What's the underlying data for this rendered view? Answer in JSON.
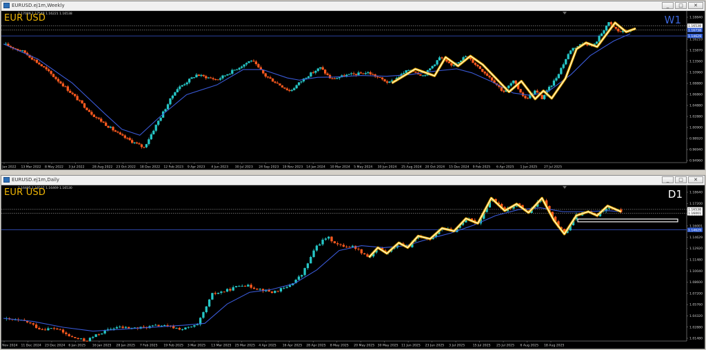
{
  "colors": {
    "background": "#000000",
    "bull_candle": "#26c6c6",
    "bear_candle": "#ff5a1f",
    "moving_average": "#3a5ad8",
    "zigzag_outer": "#f5b400",
    "zigzag_inner": "#ffffff",
    "symbol_label": "#f2b705",
    "grid_line": "#8a8a8a",
    "level_line": "#3a5ad8"
  },
  "window_buttons": [
    "minimize-icon",
    "restore-icon",
    "close-icon"
  ],
  "chart_data": [
    {
      "type": "candlestick",
      "window_title": "EURUSD.ej1m,Weekly",
      "ohlc_header": "1.17089 1.17548 1.16221 1.16538",
      "symbol_label": "EUR USD",
      "timeframe_label": "W1",
      "ylim": [
        0.9376,
        1.1945
      ],
      "y_ticks": [
        "1.18840",
        "1.16538",
        "1.16210",
        "1.15870",
        "1.13560",
        "1.10960",
        "1.08880",
        "1.06860",
        "1.04880",
        "1.02880",
        "1.00900",
        "0.98920",
        "0.96940",
        "0.94960"
      ],
      "price_markers": [
        {
          "label": "1.16538",
          "value": 1.1738,
          "bg": "#ffffff",
          "fg": "#000000"
        },
        {
          "label": "1.16738",
          "value": 1.1664,
          "bg": "#2f5bd0",
          "fg": "#ffffff"
        },
        {
          "label": "1.14629",
          "value": 1.1563,
          "bg": "#2f5bd0",
          "fg": "#ffffff"
        }
      ],
      "horizontal_lines": [
        {
          "value": 1.1738,
          "style": "dotted",
          "color": "#8a8a8a"
        },
        {
          "value": 1.1664,
          "style": "dotted",
          "color": "#8a8a8a"
        },
        {
          "value": 1.1563,
          "style": "solid",
          "color": "#3a5ad8"
        }
      ],
      "x_labels": [
        "16 Jan 2022",
        "13 Mar 2022",
        "8 May 2022",
        "3 Jul 2022",
        "28 Aug 2022",
        "23 Oct 2022",
        "18 Dec 2022",
        "12 Feb 2023",
        "9 Apr 2023",
        "4 Jun 2023",
        "30 Jul 2023",
        "24 Sep 2023",
        "19 Nov 2023",
        "14 Jan 2024",
        "10 Mar 2024",
        "5 May 2024",
        "30 Jun 2024",
        "25 Aug 2024",
        "20 Oct 2024",
        "15 Dec 2024",
        "9 Feb 2025",
        "6 Apr 2025",
        "1 Jun 2025",
        "27 Jul 2025"
      ],
      "price_path": [
        [
          0,
          1.1425
        ],
        [
          1.5,
          1.1285
        ],
        [
          3,
          1.1001
        ],
        [
          4.5,
          1.0676
        ],
        [
          6.5,
          1.0198
        ],
        [
          8.5,
          0.9844
        ],
        [
          10.2,
          0.9633
        ],
        [
          11.2,
          1.0076
        ],
        [
          12.5,
          1.0629
        ],
        [
          14,
          1.0893
        ],
        [
          15.5,
          1.0806
        ],
        [
          17,
          1.1008
        ],
        [
          18,
          1.1147
        ],
        [
          19,
          1.0875
        ],
        [
          20.8,
          1.0608
        ],
        [
          22,
          1.0864
        ],
        [
          23,
          1.1014
        ],
        [
          23.8,
          1.0814
        ],
        [
          25,
          1.0889
        ],
        [
          26.5,
          1.0929
        ],
        [
          28,
          1.0749
        ],
        [
          29.5,
          1.0992
        ],
        [
          30.5,
          1.0873
        ],
        [
          31.7,
          1.1196
        ],
        [
          32.5,
          1.1044
        ],
        [
          33.6,
          1.1216
        ],
        [
          34.3,
          1.1066
        ],
        [
          35.3,
          1.0852
        ],
        [
          36.3,
          1.0597
        ],
        [
          37,
          1.0782
        ],
        [
          37.9,
          1.0474
        ],
        [
          38.6,
          1.0616
        ],
        [
          39.1,
          1.0485
        ],
        [
          40.1,
          1.0829
        ],
        [
          41.2,
          1.1336
        ],
        [
          42.2,
          1.1446
        ],
        [
          42.8,
          1.1375
        ],
        [
          43.9,
          1.1791
        ],
        [
          44.7,
          1.1633
        ],
        [
          45.5,
          1.165
        ]
      ],
      "moving_average": [
        [
          0,
          1.1423
        ],
        [
          2.5,
          1.1163
        ],
        [
          5,
          1.0749
        ],
        [
          7.4,
          1.0211
        ],
        [
          8.6,
          0.9951
        ],
        [
          9.9,
          0.9849
        ],
        [
          11.3,
          1.0155
        ],
        [
          13.3,
          1.0549
        ],
        [
          15.5,
          1.0718
        ],
        [
          17.4,
          1.0982
        ],
        [
          18.8,
          1.0982
        ],
        [
          20.6,
          1.0838
        ],
        [
          21.5,
          1.0799
        ],
        [
          22.8,
          1.0849
        ],
        [
          24,
          1.0853
        ],
        [
          26,
          1.088
        ],
        [
          27.8,
          1.0866
        ],
        [
          29.5,
          1.0895
        ],
        [
          31.4,
          1.0957
        ],
        [
          32.9,
          1.0995
        ],
        [
          34,
          1.0926
        ],
        [
          35.5,
          1.0767
        ],
        [
          37,
          1.0578
        ],
        [
          38.3,
          1.0535
        ],
        [
          39.6,
          1.0612
        ],
        [
          41.2,
          1.0896
        ],
        [
          42.6,
          1.1223
        ],
        [
          44.3,
          1.1475
        ],
        [
          45.5,
          1.16
        ]
      ],
      "zigzag": [
        [
          28.2,
          1.0749
        ],
        [
          29.9,
          1.0992
        ],
        [
          31.3,
          1.0873
        ],
        [
          32.1,
          1.1196
        ],
        [
          33,
          1.1044
        ],
        [
          33.9,
          1.1216
        ],
        [
          34.8,
          1.1066
        ],
        [
          36.7,
          1.0597
        ],
        [
          37.6,
          1.0782
        ],
        [
          38.6,
          1.0474
        ],
        [
          39.2,
          1.0616
        ],
        [
          39.8,
          1.0485
        ],
        [
          40.8,
          1.0829
        ],
        [
          41.6,
          1.1336
        ],
        [
          42.3,
          1.1446
        ],
        [
          43.1,
          1.1375
        ],
        [
          44.4,
          1.1791
        ],
        [
          45.2,
          1.1633
        ],
        [
          45.9,
          1.1691
        ]
      ]
    },
    {
      "type": "candlestick",
      "window_title": "EURUSD.ej1m,Daily",
      "ohlc_header": "1.16495 1.16537 1.16469 1.16530",
      "symbol_label": "EUR USD",
      "timeframe_label": "D1",
      "ylim": [
        1.0318,
        1.1893
      ],
      "y_ticks": [
        "1.18640",
        "1.17200",
        "1.16538",
        "1.16001",
        "1.14629",
        "1.12920",
        "1.11480",
        "1.10040",
        "1.08600",
        "1.07200",
        "1.05760",
        "1.04320",
        "1.02880",
        "1.01480"
      ],
      "price_markers": [
        {
          "label": "1.16538",
          "value": 1.1674,
          "bg": "#ffffff",
          "fg": "#000000"
        },
        {
          "label": "1.16001",
          "value": 1.1634,
          "bg": "#ffffff",
          "fg": "#000000"
        },
        {
          "label": "1.14629",
          "value": 1.1463,
          "bg": "#2f5bd0",
          "fg": "#ffffff"
        }
      ],
      "horizontal_lines": [
        {
          "value": 1.1674,
          "style": "dotted",
          "color": "#8a8a8a"
        },
        {
          "value": 1.1634,
          "style": "dotted",
          "color": "#8a8a8a"
        },
        {
          "value": 1.1463,
          "style": "solid",
          "color": "#3a5ad8"
        }
      ],
      "highlight_box": {
        "x_start": 38.5,
        "x_end": 45.2,
        "value": 1.156
      },
      "x_labels": [
        "29 Nov 2024",
        "11 Dec 2024",
        "23 Dec 2024",
        "6 Jan 2025",
        "16 Jan 2025",
        "28 Jan 2025",
        "7 Feb 2025",
        "19 Feb 2025",
        "3 Mar 2025",
        "13 Mar 2025",
        "25 Mar 2025",
        "4 Apr 2025",
        "16 Apr 2025",
        "28 Apr 2025",
        "8 May 2025",
        "20 May 2025",
        "30 May 2025",
        "11 Jun 2025",
        "23 Jun 2025",
        "3 Jul 2025",
        "15 Jul 2025",
        "25 Jul 2025",
        "6 Aug 2025",
        "18 Aug 2025"
      ],
      "price_path": [
        [
          0,
          1.0545
        ],
        [
          1.5,
          1.052
        ],
        [
          2.5,
          1.044
        ],
        [
          3.5,
          1.045
        ],
        [
          4.5,
          1.036
        ],
        [
          5.5,
          1.032
        ],
        [
          6.5,
          1.04
        ],
        [
          7.5,
          1.046
        ],
        [
          9,
          1.045
        ],
        [
          10.5,
          1.048
        ],
        [
          12,
          1.044
        ],
        [
          13,
          1.048
        ],
        [
          14,
          1.08
        ],
        [
          15,
          1.084
        ],
        [
          16,
          1.09
        ],
        [
          17,
          1.086
        ],
        [
          18,
          1.082
        ],
        [
          19,
          1.087
        ],
        [
          20,
          1.1
        ],
        [
          21,
          1.13
        ],
        [
          21.7,
          1.139
        ],
        [
          22.5,
          1.13
        ],
        [
          23.5,
          1.129
        ],
        [
          24.5,
          1.118
        ],
        [
          25.1,
          1.128
        ],
        [
          25.7,
          1.122
        ],
        [
          26.5,
          1.133
        ],
        [
          27.1,
          1.128
        ],
        [
          27.8,
          1.14
        ],
        [
          28.6,
          1.137
        ],
        [
          29.4,
          1.148
        ],
        [
          30.2,
          1.145
        ],
        [
          31,
          1.158
        ],
        [
          31.8,
          1.153
        ],
        [
          32.7,
          1.179
        ],
        [
          33.6,
          1.166
        ],
        [
          34.4,
          1.173
        ],
        [
          35.2,
          1.164
        ],
        [
          36.1,
          1.179
        ],
        [
          36.9,
          1.156
        ],
        [
          37.6,
          1.142
        ],
        [
          38.4,
          1.161
        ],
        [
          39.2,
          1.165
        ],
        [
          39.8,
          1.161
        ],
        [
          40.5,
          1.171
        ],
        [
          41.4,
          1.165
        ]
      ],
      "moving_average": [
        [
          0,
          1.0552
        ],
        [
          2,
          1.052
        ],
        [
          4,
          1.046
        ],
        [
          6,
          1.042
        ],
        [
          8,
          1.044
        ],
        [
          10,
          1.046
        ],
        [
          12,
          1.048
        ],
        [
          13.5,
          1.05
        ],
        [
          15,
          1.07
        ],
        [
          16.5,
          1.082
        ],
        [
          18,
          1.085
        ],
        [
          19.5,
          1.091
        ],
        [
          21,
          1.105
        ],
        [
          22.5,
          1.125
        ],
        [
          24,
          1.13
        ],
        [
          25.5,
          1.128
        ],
        [
          27,
          1.13
        ],
        [
          28.5,
          1.137
        ],
        [
          30,
          1.143
        ],
        [
          31.5,
          1.151
        ],
        [
          33,
          1.161
        ],
        [
          34.5,
          1.167
        ],
        [
          36,
          1.169
        ],
        [
          37.5,
          1.165
        ],
        [
          39,
          1.165
        ],
        [
          40.5,
          1.166
        ],
        [
          41.4,
          1.165
        ]
      ],
      "zigzag": [
        [
          24.5,
          1.118
        ],
        [
          25.1,
          1.128
        ],
        [
          25.7,
          1.122
        ],
        [
          26.5,
          1.133
        ],
        [
          27.1,
          1.128
        ],
        [
          27.8,
          1.14
        ],
        [
          28.6,
          1.137
        ],
        [
          29.4,
          1.148
        ],
        [
          30.2,
          1.145
        ],
        [
          31,
          1.158
        ],
        [
          31.8,
          1.153
        ],
        [
          32.7,
          1.179
        ],
        [
          33.6,
          1.166
        ],
        [
          34.4,
          1.173
        ],
        [
          35.2,
          1.164
        ],
        [
          36.1,
          1.179
        ],
        [
          36.9,
          1.156
        ],
        [
          37.6,
          1.142
        ],
        [
          38.4,
          1.161
        ],
        [
          39.2,
          1.165
        ],
        [
          39.8,
          1.161
        ],
        [
          40.5,
          1.171
        ],
        [
          41.4,
          1.165
        ]
      ]
    }
  ]
}
